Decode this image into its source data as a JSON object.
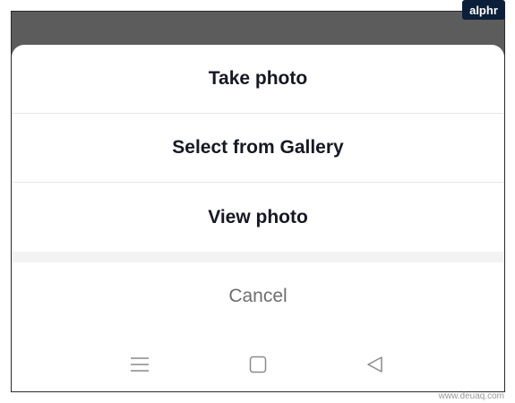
{
  "sheet": {
    "options": [
      {
        "label": "Take photo"
      },
      {
        "label": "Select from Gallery"
      },
      {
        "label": "View photo"
      }
    ],
    "cancel_label": "Cancel"
  },
  "navbar": {
    "menu_icon": "menu-icon",
    "home_icon": "square-home-icon",
    "back_icon": "triangle-back-icon"
  },
  "branding": {
    "logo_text": "alphr",
    "watermark_text": "www.deuaq.com"
  },
  "colors": {
    "overlay": "#5c5c5c",
    "sheet": "#ffffff",
    "option_text": "#161823",
    "cancel_text": "#6f6f6f",
    "logo_bg": "#0b1f3a"
  }
}
